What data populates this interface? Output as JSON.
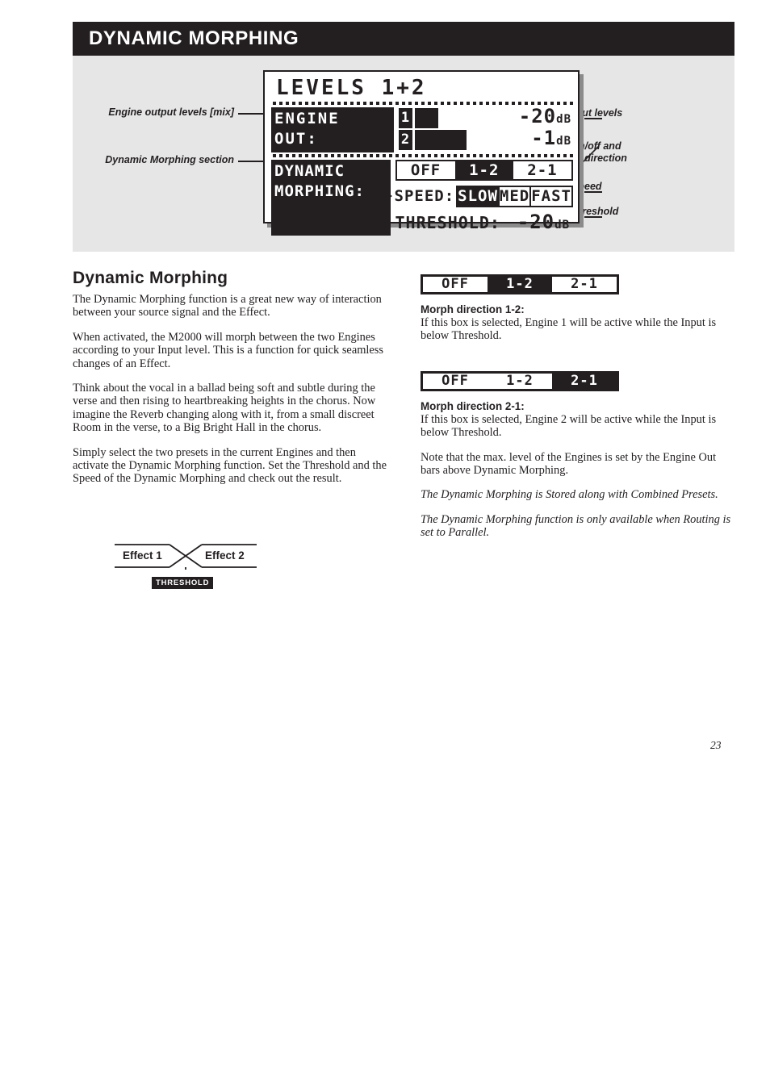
{
  "header": {
    "title": "DYNAMIC MORPHING"
  },
  "figure": {
    "callouts_left": [
      {
        "text": "Engine output levels [mix]"
      },
      {
        "text": "Dynamic Morphing section"
      }
    ],
    "callouts_right": [
      {
        "text": "Engine output levels"
      },
      {
        "line1": "Morphing on/off and",
        "line2": "morphing direction"
      },
      {
        "text": "Morphing speed"
      },
      {
        "text": "Morphing threshold"
      }
    ],
    "lcd": {
      "title": "LEVELS 1+2",
      "engine_out_label_line1": "ENGINE",
      "engine_out_label_line2": "OUT:",
      "bars": [
        {
          "index": "1",
          "fill_pct": 33,
          "value": "-20",
          "unit": "dB"
        },
        {
          "index": "2",
          "fill_pct": 73,
          "value": "-1",
          "unit": "dB"
        }
      ],
      "dynamic_label_line1": "DYNAMIC",
      "dynamic_label_line2": "MORPHING:",
      "direction_options": [
        {
          "label": "OFF",
          "selected": false
        },
        {
          "label": "1-2",
          "selected": true
        },
        {
          "label": "2-1",
          "selected": false
        }
      ],
      "speed_label": "SPEED:",
      "speed_options": [
        {
          "label": "SLOW",
          "selected": true
        },
        {
          "label": "MED",
          "selected": false
        },
        {
          "label": "FAST",
          "selected": false
        }
      ],
      "threshold_label": "THRESHOLD:",
      "threshold_value": "-20",
      "threshold_unit": "dB"
    }
  },
  "left_column": {
    "title": "Dynamic Morphing",
    "paragraphs": [
      "The Dynamic Morphing function is a great new way of interaction between your source signal and the Effect.",
      "When activated, the M2000 will morph between the two Engines according to your Input level. This is a function for quick seamless changes of an Effect.",
      "Think about the vocal in a ballad being soft and subtle during the verse and then rising to heartbreaking heights in the chorus. Now imagine the Reverb changing along with it, from a small discreet Room in the verse, to a Big Bright Hall in the chorus.",
      "Simply select the two presets in the current Engines and then activate the Dynamic Morphing function. Set the Threshold and the Speed of the Dynamic Morphing and check out the result."
    ],
    "diagram": {
      "effect1": "Effect 1",
      "effect2": "Effect 2",
      "threshold_chip": "THRESHOLD"
    }
  },
  "right_column": {
    "box1": [
      {
        "label": "OFF",
        "selected": false
      },
      {
        "label": "1-2",
        "selected": true
      },
      {
        "label": "2-1",
        "selected": false
      }
    ],
    "heading1": "Morph direction 1-2:",
    "text1": "If this box is selected, Engine 1 will be active while the Input is below Threshold.",
    "box2": [
      {
        "label": "OFF",
        "selected": false
      },
      {
        "label": "1-2",
        "selected": false
      },
      {
        "label": "2-1",
        "selected": true
      }
    ],
    "heading2": "Morph direction 2-1:",
    "text2": "If this box is selected, Engine 2 will be active while the Input is below Threshold.",
    "note": "Note that the max. level of the Engines is set by the Engine Out bars above Dynamic Morphing.",
    "italic1": "The Dynamic Morphing is Stored along with Combined Presets.",
    "italic2": "The Dynamic Morphing function is only available when Routing is set to Parallel."
  },
  "footer": {
    "page_number": "23"
  },
  "colors": {
    "ink": "#231f20",
    "panel": "#e6e6e6",
    "shadow": "#8b8b8b"
  }
}
